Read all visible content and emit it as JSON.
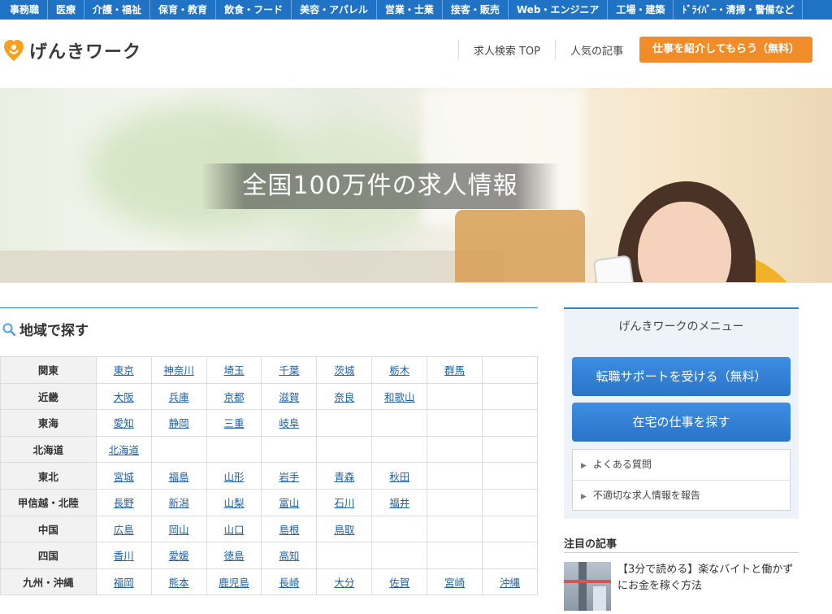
{
  "categories": [
    "事務職",
    "医療",
    "介護・福祉",
    "保育・教育",
    "飲食・フード",
    "美容・アパレル",
    "営業・士業",
    "接客・販売",
    "Web・エンジニア",
    "工場・建築",
    "ﾄﾞﾗｲﾊﾞｰ・清掃・警備など"
  ],
  "header": {
    "logo_text": "げんきワーク",
    "nav": [
      "求人検索 TOP",
      "人気の記事"
    ],
    "cta": "仕事を紹介してもらう（無料）"
  },
  "hero": {
    "caption": "全国100万件の求人情報"
  },
  "region_search": {
    "title": "地域で探す",
    "rows": [
      {
        "region": "関東",
        "prefs": [
          "東京",
          "神奈川",
          "埼玉",
          "千葉",
          "茨城",
          "栃木",
          "群馬"
        ]
      },
      {
        "region": "近畿",
        "prefs": [
          "大阪",
          "兵庫",
          "京都",
          "滋賀",
          "奈良",
          "和歌山"
        ]
      },
      {
        "region": "東海",
        "prefs": [
          "愛知",
          "静岡",
          "三重",
          "岐阜"
        ]
      },
      {
        "region": "北海道",
        "prefs": [
          "北海道"
        ]
      },
      {
        "region": "東北",
        "prefs": [
          "宮城",
          "福島",
          "山形",
          "岩手",
          "青森",
          "秋田"
        ]
      },
      {
        "region": "甲信越・北陸",
        "prefs": [
          "長野",
          "新潟",
          "山梨",
          "富山",
          "石川",
          "福井"
        ]
      },
      {
        "region": "中国",
        "prefs": [
          "広島",
          "岡山",
          "山口",
          "島根",
          "鳥取"
        ]
      },
      {
        "region": "四国",
        "prefs": [
          "香川",
          "愛媛",
          "徳島",
          "高知"
        ]
      },
      {
        "region": "九州・沖縄",
        "prefs": [
          "福岡",
          "熊本",
          "鹿児島",
          "長崎",
          "大分",
          "佐賀",
          "宮崎",
          "沖縄"
        ]
      }
    ]
  },
  "sidebar": {
    "menu_title": "げんきワークのメニュー",
    "buttons": [
      "転職サポートを受ける（無料）",
      "在宅の仕事を探す"
    ],
    "links": [
      "よくある質問",
      "不適切な求人情報を報告"
    ],
    "featured_title": "注目の記事",
    "featured_article": "【3分で読める】楽なバイトと働かずにお金を稼ぐ方法"
  },
  "colors": {
    "primary": "#1f72c4",
    "accent": "#f28c28",
    "link": "#1e5fa8"
  }
}
